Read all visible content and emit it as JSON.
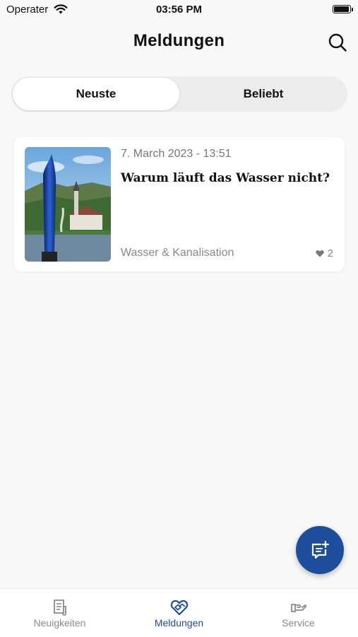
{
  "status": {
    "carrier": "Operater",
    "time": "03:56 PM"
  },
  "header": {
    "title": "Meldungen"
  },
  "segments": {
    "newest": "Neuste",
    "popular": "Beliebt",
    "selected": "Neuste"
  },
  "reports": [
    {
      "date": "7. March 2023 - 13:51",
      "title": "Warum läuft das Wasser nicht?",
      "category": "Wasser & Kanalisation",
      "likes": "2"
    }
  ],
  "tabs": [
    {
      "label": "Neuigkeiten",
      "icon": "newspaper-icon"
    },
    {
      "label": "Meldungen",
      "icon": "heart-report-icon",
      "active": true
    },
    {
      "label": "Service",
      "icon": "helping-hand-icon"
    }
  ],
  "colors": {
    "accent": "#1c4e9c",
    "background": "#f8f8f8",
    "inactive": "#8a8a8a"
  }
}
